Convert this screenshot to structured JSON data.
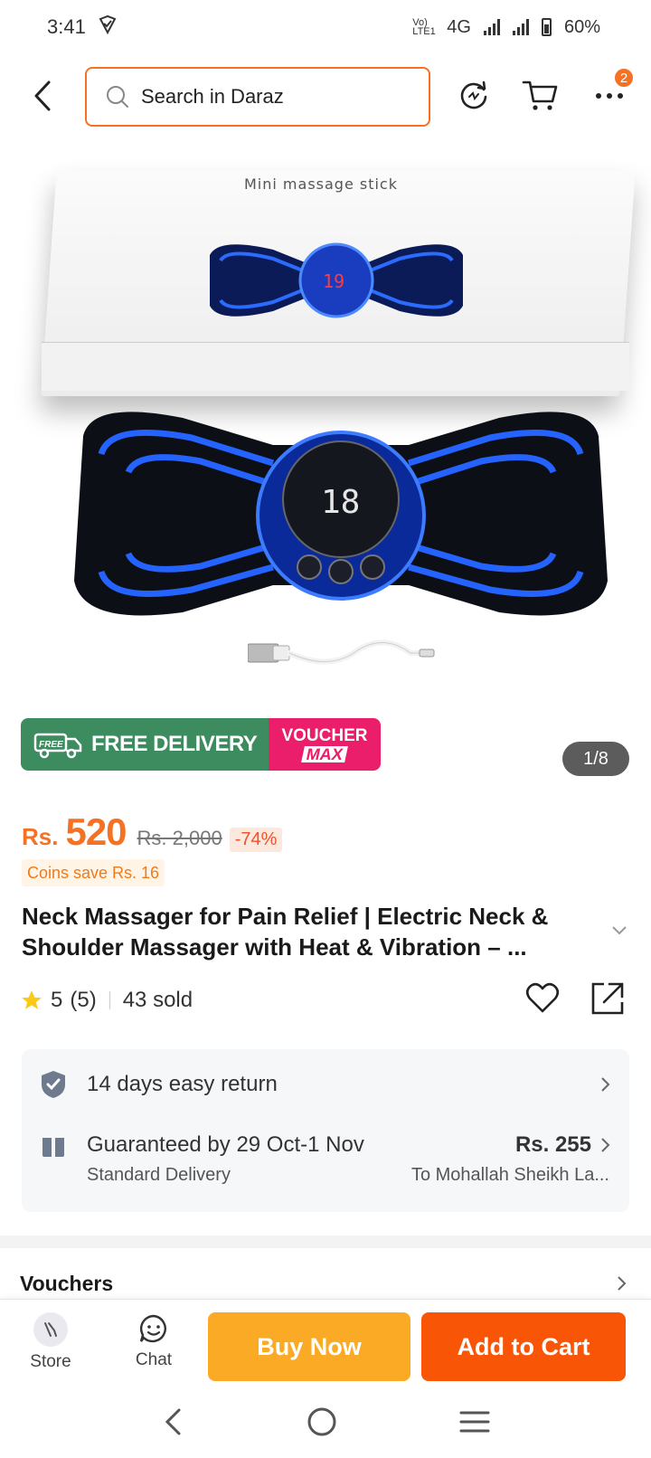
{
  "status_bar": {
    "time": "3:41",
    "network": "4G",
    "lte_label": "Vo) LTE1",
    "battery": "60%"
  },
  "search": {
    "placeholder": "Search in Daraz"
  },
  "nav": {
    "more_badge": "2"
  },
  "product_image": {
    "box_title": "Mini massage stick",
    "promo_free_delivery": "FREE DELIVERY",
    "promo_free_tag": "FREE",
    "promo_voucher": "VOUCHER",
    "promo_max": "MAX",
    "counter": "1/8"
  },
  "price": {
    "currency": "Rs.",
    "current": "520",
    "original": "Rs. 2,000",
    "discount": "-74%",
    "coins": "Coins save Rs. 16"
  },
  "product": {
    "title": "Neck Massager for Pain Relief | Electric Neck & Shoulder Massager with Heat & Vibration – ...",
    "rating": "5",
    "rating_count": "(5)",
    "sold": "43 sold"
  },
  "info": {
    "return_text": "14 days easy return",
    "delivery_text": "Guaranteed by 29 Oct-1 Nov",
    "delivery_price": "Rs. 255",
    "delivery_type": "Standard Delivery",
    "delivery_location": "To Mohallah Sheikh La..."
  },
  "vouchers": {
    "label": "Vouchers"
  },
  "action_bar": {
    "store_label": "Store",
    "chat_label": "Chat",
    "buy_now": "Buy Now",
    "add_to_cart": "Add to Cart"
  },
  "colors": {
    "brand_orange": "#f57224",
    "buy_now": "#fbaa26",
    "add_to_cart": "#f85606",
    "free_delivery_green": "#3c8c5f",
    "voucher_pink": "#ea1e6a"
  }
}
